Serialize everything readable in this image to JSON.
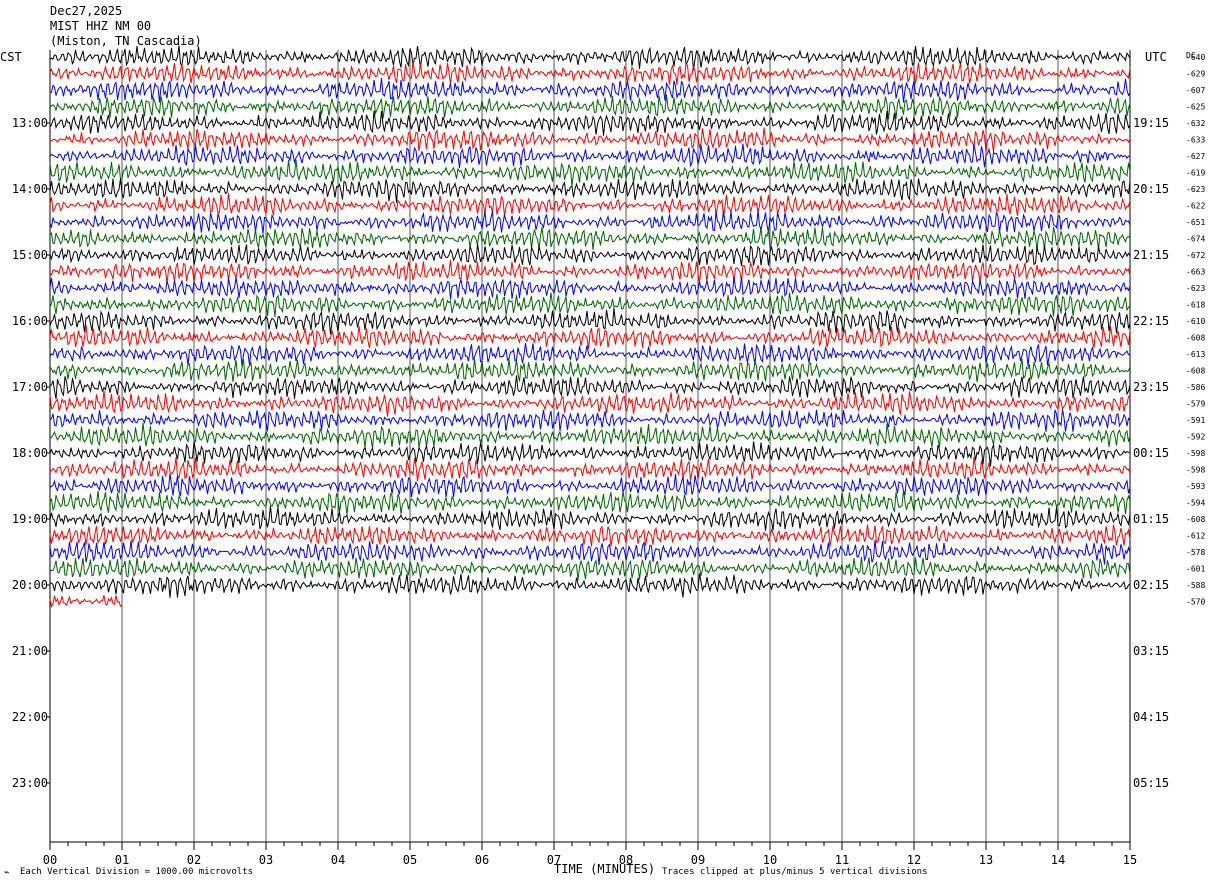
{
  "header": {
    "date": "Dec27,2025",
    "station": "MIST HHZ NM 00",
    "location": "(Miston, TN Cascadia)"
  },
  "axes": {
    "left_label": "CST",
    "right_label": "UTC",
    "dc_label": "DC",
    "x_title": "TIME (MINUTES)",
    "x_ticks": [
      "00",
      "01",
      "02",
      "03",
      "04",
      "05",
      "06",
      "07",
      "08",
      "09",
      "10",
      "11",
      "12",
      "13",
      "14",
      "15"
    ],
    "left_hours": [
      "13:00",
      "14:00",
      "15:00",
      "16:00",
      "17:00",
      "18:00",
      "19:00",
      "20:00",
      "21:00",
      "22:00",
      "23:00"
    ],
    "right_hours": [
      "19:15",
      "20:15",
      "21:15",
      "22:15",
      "23:15",
      "00:15",
      "01:15",
      "02:15",
      "03:15",
      "04:15",
      "05:15"
    ]
  },
  "footer": {
    "scale_note": "Each Vertical Division = 1000.00 microvolts",
    "clip_note": "Traces clipped at plus/minus 5 vertical divisions"
  },
  "chart_data": {
    "type": "line",
    "title": "",
    "x_unit": "minutes",
    "xlim": [
      0,
      15
    ],
    "trace_duration_minutes": 15,
    "series_colors": [
      "#000000",
      "#ff0000",
      "#0000ff",
      "#006400"
    ],
    "traces": [
      {
        "dc": "-640",
        "end_minute": 15
      },
      {
        "dc": "-629",
        "end_minute": 15
      },
      {
        "dc": "-607",
        "end_minute": 15
      },
      {
        "dc": "-625",
        "end_minute": 15
      },
      {
        "dc": "-632",
        "end_minute": 15
      },
      {
        "dc": "-633",
        "end_minute": 15
      },
      {
        "dc": "-627",
        "end_minute": 15
      },
      {
        "dc": "-619",
        "end_minute": 15
      },
      {
        "dc": "-623",
        "end_minute": 15
      },
      {
        "dc": "-622",
        "end_minute": 15
      },
      {
        "dc": "-651",
        "end_minute": 15
      },
      {
        "dc": "-674",
        "end_minute": 15
      },
      {
        "dc": "-672",
        "end_minute": 15
      },
      {
        "dc": "-663",
        "end_minute": 15
      },
      {
        "dc": "-623",
        "end_minute": 15
      },
      {
        "dc": "-618",
        "end_minute": 15
      },
      {
        "dc": "-610",
        "end_minute": 15
      },
      {
        "dc": "-608",
        "end_minute": 15
      },
      {
        "dc": "-613",
        "end_minute": 15
      },
      {
        "dc": "-608",
        "end_minute": 15
      },
      {
        "dc": "-586",
        "end_minute": 15
      },
      {
        "dc": "-579",
        "end_minute": 15
      },
      {
        "dc": "-591",
        "end_minute": 15
      },
      {
        "dc": "-592",
        "end_minute": 15
      },
      {
        "dc": "-598",
        "end_minute": 15
      },
      {
        "dc": "-598",
        "end_minute": 15
      },
      {
        "dc": "-593",
        "end_minute": 15
      },
      {
        "dc": "-594",
        "end_minute": 15
      },
      {
        "dc": "-608",
        "end_minute": 15
      },
      {
        "dc": "-612",
        "end_minute": 15
      },
      {
        "dc": "-578",
        "end_minute": 15
      },
      {
        "dc": "-601",
        "end_minute": 15
      },
      {
        "dc": "-588",
        "end_minute": 15
      },
      {
        "dc": "-570",
        "end_minute": 1
      }
    ]
  }
}
